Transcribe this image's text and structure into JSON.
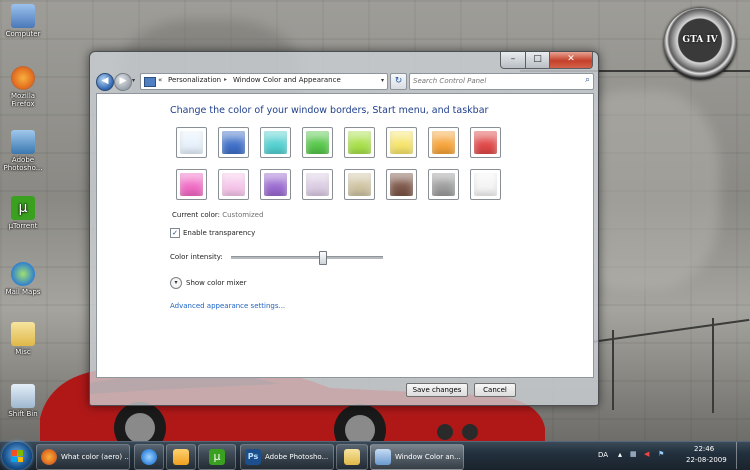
{
  "desktop": {
    "icons": [
      {
        "label": "Computer",
        "color": "#4a78b8"
      },
      {
        "label": "Mozilla Firefox",
        "color": "#e36d1e"
      },
      {
        "label": "Adobe Photosho...",
        "color": "#3a78b0"
      },
      {
        "label": "µTorrent",
        "color": "#3aa020"
      },
      {
        "label": "Mail Maps",
        "color": "#2f7fd0"
      },
      {
        "label": "Misc",
        "color": "#e6c660"
      },
      {
        "label": "Shift Bin",
        "color": "#9fb8cf"
      }
    ],
    "badge_text": "GTA IV"
  },
  "window": {
    "controls": {
      "minimize": "–",
      "maximize": "□",
      "close": "✕"
    },
    "address": {
      "crumbs": [
        "Personalization",
        "Window Color and Appearance"
      ],
      "prefix": "«"
    },
    "search": {
      "placeholder": "Search Control Panel"
    },
    "heading": "Change the color of your window borders, Start menu, and taskbar",
    "swatches": [
      "#e7f1fb",
      "#3f6fc8",
      "#52d0d0",
      "#56c64a",
      "#a8e04a",
      "#f6e46c",
      "#f6a43a",
      "#e04848",
      "#f06ac4",
      "#f6c4ea",
      "#9a6ad0",
      "#dacbe2",
      "#cfc3a2",
      "#7c5648",
      "#9c9c9c",
      "#f4f4f4"
    ],
    "current_color_label": "Current color:",
    "current_color_value": "Customized",
    "enable_transparency_label": "Enable transparency",
    "enable_transparency_checked": true,
    "intensity_label": "Color intensity:",
    "intensity_value": 0.6,
    "show_mixer_label": "Show color mixer",
    "advanced_link": "Advanced appearance settings...",
    "save_label": "Save changes",
    "cancel_label": "Cancel"
  },
  "taskbar": {
    "buttons": [
      {
        "label": "What color (aero) ...",
        "color": "#e36d1e"
      },
      {
        "label": "",
        "color": "#3a8ae0"
      },
      {
        "label": "",
        "color": "#f0a020"
      },
      {
        "label": "",
        "color": "#3aa020"
      },
      {
        "label": "Adobe Photosho...",
        "color": "#1c4f8c"
      },
      {
        "label": "",
        "color": "#e6c660"
      },
      {
        "label": "Window Color an...",
        "color": "#6a9ad0"
      }
    ],
    "language": "DA",
    "time": "22:46",
    "date": "22-08-2009"
  }
}
